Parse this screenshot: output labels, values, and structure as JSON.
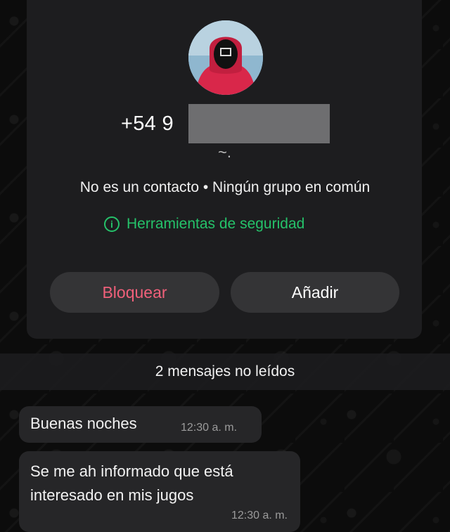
{
  "contact": {
    "phone_prefix": "+54 9",
    "about": "~.",
    "info_line": "No es un contacto • Ningún grupo en común",
    "safety_tools_label": "Herramientas de seguridad"
  },
  "actions": {
    "block_label": "Bloquear",
    "add_label": "Añadir"
  },
  "unread_banner": "2 mensajes no leídos",
  "messages": [
    {
      "text": "Buenas noches",
      "time": "12:30 a. m."
    },
    {
      "text": "Se me ah informado que está interesado en mis jugos",
      "time": "12:30 a. m."
    }
  ],
  "colors": {
    "accent_green": "#25c26a",
    "block_red": "#f0607a",
    "card_bg": "#1d1d1f",
    "bubble_bg": "#262628"
  },
  "icons": {
    "avatar": "avatar-masked-figure",
    "safety": "info-circle-icon"
  }
}
